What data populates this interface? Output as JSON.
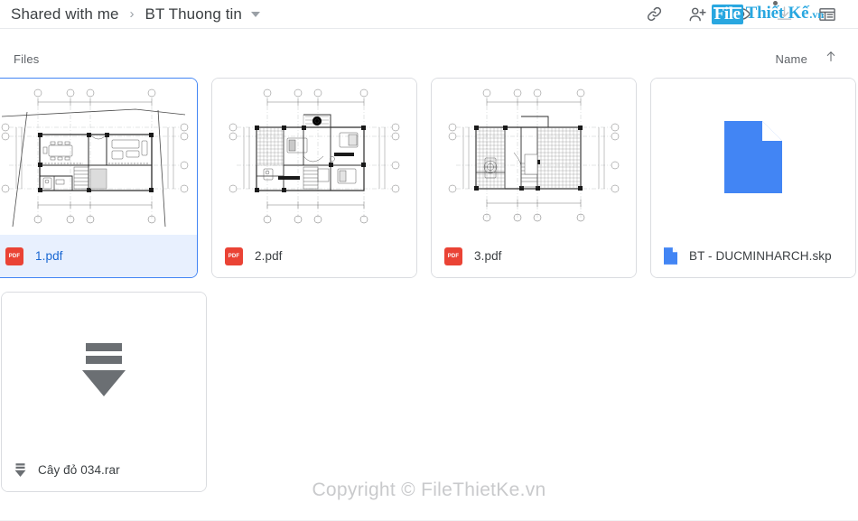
{
  "topbar": {
    "breadcrumb": {
      "root_label": "Shared with me",
      "separator": "›",
      "current_label": "BT Thuong tin",
      "caret_icon": "chevron-down-icon"
    },
    "actions": [
      {
        "name": "link-icon",
        "title": "Get link"
      },
      {
        "name": "add-person-icon",
        "title": "Share"
      },
      {
        "name": "eye-icon",
        "title": "Preview"
      },
      {
        "name": "download-icon",
        "title": "Download"
      },
      {
        "name": "list-view-icon",
        "title": "List view"
      }
    ]
  },
  "watermark_logo": {
    "part1": "File",
    "part2": "Thiết Kế",
    "part3": ".vn",
    "color": "#29a7e0"
  },
  "files_bar": {
    "title": "Files",
    "sort_label": "Name",
    "sort_direction_icon": "arrow-up-icon"
  },
  "files": [
    {
      "name": "1.pdf",
      "type": "pdf",
      "badge_text": "PDF",
      "selected": true,
      "thumb": "floor-plan-ground"
    },
    {
      "name": "2.pdf",
      "type": "pdf",
      "badge_text": "PDF",
      "selected": false,
      "thumb": "floor-plan-first"
    },
    {
      "name": "3.pdf",
      "type": "pdf",
      "badge_text": "PDF",
      "selected": false,
      "thumb": "floor-plan-roof"
    },
    {
      "name": "BT - DUCMINHARCH.skp",
      "type": "skp",
      "badge_text": "",
      "selected": false,
      "thumb": "generic-doc"
    },
    {
      "name": "Cây đỏ 034.rar",
      "type": "rar",
      "badge_text": "",
      "selected": false,
      "thumb": "archive"
    }
  ],
  "center_watermark": {
    "text": "Copyright © FileThietKe.vn",
    "color": "#c9cacc"
  },
  "colors": {
    "accent_blue": "#4285f4",
    "selected_bg": "#e8f0fe",
    "selected_text": "#1967d2",
    "pdf_red": "#ea4335",
    "border": "#dadce0",
    "text_primary": "#3c4043",
    "text_secondary": "#5f6368",
    "watermark_blue": "#29a7e0"
  }
}
